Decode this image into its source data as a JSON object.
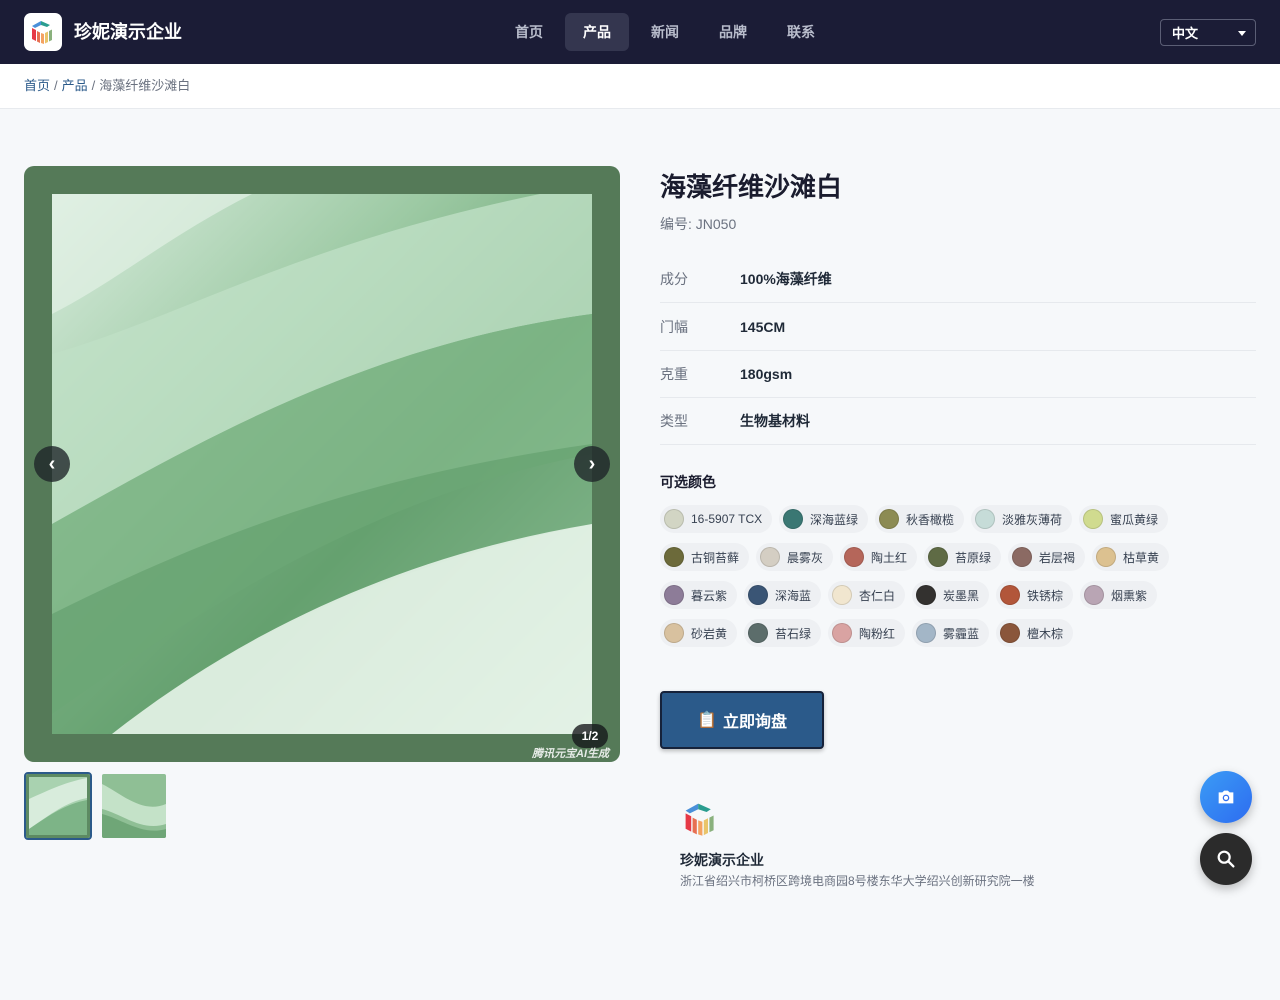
{
  "header": {
    "brand": "珍妮演示企业",
    "nav": [
      "首页",
      "产品",
      "新闻",
      "品牌",
      "联系"
    ],
    "active_nav": "产品",
    "language": "中文"
  },
  "breadcrumb": {
    "home": "首页",
    "products": "产品",
    "current": "海藻纤维沙滩白",
    "separator": "/"
  },
  "gallery": {
    "counter": "1/2",
    "prev": "‹",
    "next": "›",
    "watermark": "腾讯元宝AI生成",
    "image_count": 2,
    "current_index": 1
  },
  "product": {
    "title": "海藻纤维沙滩白",
    "code": "编号: JN050",
    "specs": [
      {
        "label": "成分",
        "value": "100%海藻纤维"
      },
      {
        "label": "门幅",
        "value": "145CM"
      },
      {
        "label": "克重",
        "value": "180gsm"
      },
      {
        "label": "类型",
        "value": "生物基材料"
      }
    ],
    "colors_title": "可选颜色",
    "colors": [
      {
        "name": "16-5907 TCX",
        "hex": "#d2d5c4"
      },
      {
        "name": "深海蓝绿",
        "hex": "#3a7773"
      },
      {
        "name": "秋香橄榄",
        "hex": "#8c8b53"
      },
      {
        "name": "淡雅灰薄荷",
        "hex": "#c6dcd8"
      },
      {
        "name": "蜜瓜黄绿",
        "hex": "#d0db8f"
      },
      {
        "name": "古铜苔藓",
        "hex": "#6c6a3a"
      },
      {
        "name": "晨雾灰",
        "hex": "#d4cec3"
      },
      {
        "name": "陶土红",
        "hex": "#b5665a"
      },
      {
        "name": "苔原绿",
        "hex": "#5f6b45"
      },
      {
        "name": "岩层褐",
        "hex": "#8b6a63"
      },
      {
        "name": "枯草黄",
        "hex": "#dcc190"
      },
      {
        "name": "暮云紫",
        "hex": "#8d7c98"
      },
      {
        "name": "深海蓝",
        "hex": "#3a5575"
      },
      {
        "name": "杏仁白",
        "hex": "#f1e6cf"
      },
      {
        "name": "炭墨黑",
        "hex": "#33312f"
      },
      {
        "name": "铁锈棕",
        "hex": "#b2563a"
      },
      {
        "name": "烟熏紫",
        "hex": "#b9a5b4"
      },
      {
        "name": "砂岩黄",
        "hex": "#d8c19f"
      },
      {
        "name": "苔石绿",
        "hex": "#5c6d6b"
      },
      {
        "name": "陶粉红",
        "hex": "#d9a3a2"
      },
      {
        "name": "雾霾蓝",
        "hex": "#a3b6c7"
      },
      {
        "name": "檀木棕",
        "hex": "#8a563b"
      }
    ],
    "inquiry_button": "立即询盘",
    "inquiry_icon": "clipboard-icon"
  },
  "company": {
    "name": "珍妮演示企业",
    "address": "浙江省绍兴市柯桥区跨境电商园8号楼东华大学绍兴创新研究院一楼"
  },
  "floating": {
    "camera_icon": "camera-icon",
    "search_icon": "search-icon"
  },
  "colors": {
    "header_bg": "#1b1c36",
    "accent": "#2b5a8a",
    "fabric": "#7fb386"
  }
}
